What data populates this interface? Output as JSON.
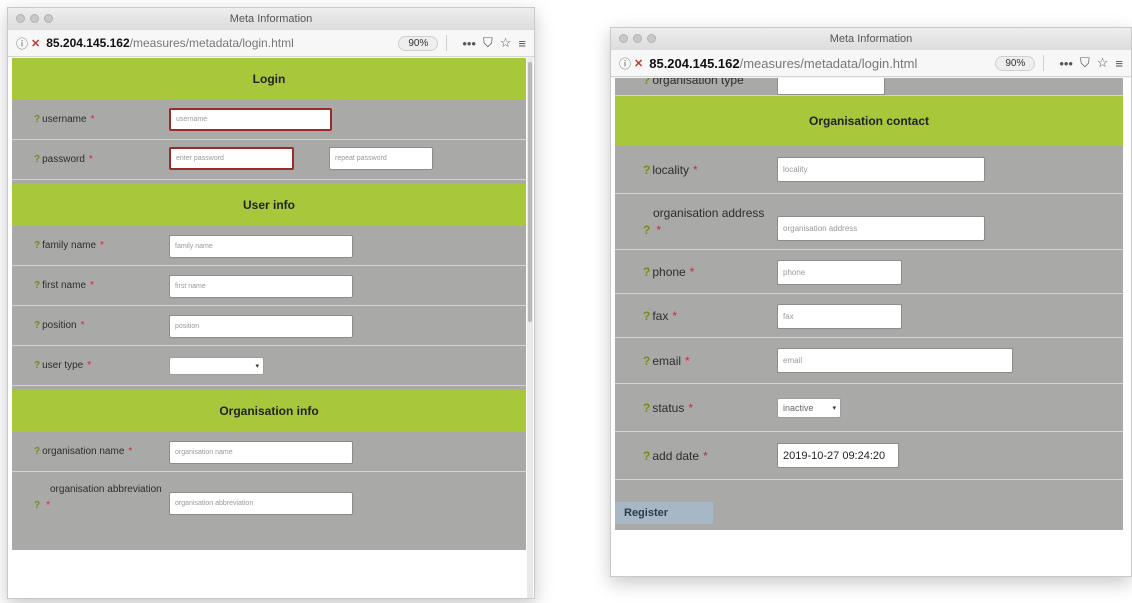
{
  "left": {
    "window_title": "Meta Information",
    "url_host": "85.204.145.162",
    "url_path": "/measures/metadata/login.html",
    "zoom": "90%",
    "sections": {
      "login": "Login",
      "user_info": "User info",
      "organisation_info": "Organisation info"
    },
    "fields": {
      "username": {
        "label": "username",
        "placeholder": "username"
      },
      "password": {
        "label": "password",
        "placeholder": "enter password",
        "repeat_placeholder": "repeat password"
      },
      "family_name": {
        "label": "family name",
        "placeholder": "family name"
      },
      "first_name": {
        "label": "first name",
        "placeholder": "first name"
      },
      "position": {
        "label": "position",
        "placeholder": "position"
      },
      "user_type": {
        "label": "user type",
        "value": ""
      },
      "organisation_name": {
        "label": "organisation name",
        "placeholder": "organisation name"
      },
      "organisation_abbreviation": {
        "label": "organisation abbreviation",
        "placeholder": "organisation abbreviation"
      }
    }
  },
  "right": {
    "window_title": "Meta Information",
    "url_host": "85.204.145.162",
    "url_path": "/measures/metadata/login.html",
    "zoom": "90%",
    "partial_label": "organisation type",
    "sections": {
      "organisation_contact": "Organisation contact"
    },
    "fields": {
      "locality": {
        "label": "locality",
        "placeholder": "locality"
      },
      "organisation_address": {
        "label": "organisation address",
        "placeholder": "organisation address"
      },
      "phone": {
        "label": "phone",
        "placeholder": "phone"
      },
      "fax": {
        "label": "fax",
        "placeholder": "fax"
      },
      "email": {
        "label": "email",
        "placeholder": "email"
      },
      "status": {
        "label": "status",
        "value": "inactive"
      },
      "add_date": {
        "label": "add date",
        "value": "2019-10-27 09:24:20"
      }
    },
    "register_label": "Register"
  },
  "common": {
    "help_glyph": "?",
    "required_glyph": "*",
    "info_icon": "ⓘ",
    "lock_icon": "🔒",
    "more_icon": "•••",
    "pocket_icon": "⛉",
    "star_icon": "☆",
    "menu_icon": "≡",
    "colors": {
      "section_green": "#a8c83c",
      "form_gray": "#a9a9a7",
      "error_red": "#9c2a2a"
    }
  }
}
